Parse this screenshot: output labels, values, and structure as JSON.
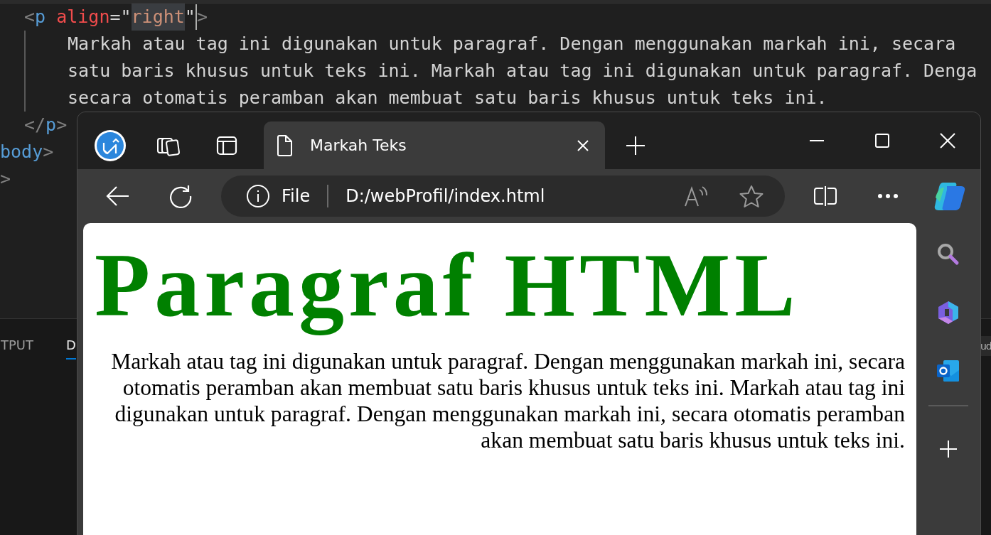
{
  "editor": {
    "lines": [
      {
        "kind": "tag",
        "tokens": [
          {
            "kind": "bracket",
            "text": "<"
          },
          {
            "kind": "tag",
            "text": "p"
          },
          {
            "kind": "attr",
            "text": " align"
          },
          {
            "kind": "plain",
            "text": "=\""
          },
          {
            "kind": "selected-string",
            "text": "right"
          },
          {
            "kind": "plain",
            "text": "\""
          },
          {
            "kind": "bracket",
            "text": ">"
          }
        ]
      },
      {
        "kind": "text",
        "tokens": [
          {
            "kind": "text",
            "text": "Markah atau tag ini digunakan untuk paragraf. Dengan menggunakan markah ini, secara"
          }
        ]
      },
      {
        "kind": "text",
        "tokens": [
          {
            "kind": "text",
            "text": "satu baris khusus untuk teks ini. Markah atau tag ini digunakan untuk paragraf. Denga"
          }
        ]
      },
      {
        "kind": "text",
        "tokens": [
          {
            "kind": "text",
            "text": "secara otomatis peramban akan membuat satu baris khusus untuk teks ini."
          }
        ]
      },
      {
        "kind": "tag",
        "tokens": [
          {
            "kind": "bracket",
            "text": "</"
          },
          {
            "kind": "tag",
            "text": "p"
          },
          {
            "kind": "bracket",
            "text": ">"
          }
        ]
      },
      {
        "kind": "outer",
        "tokens": [
          {
            "kind": "tag",
            "text": "body"
          },
          {
            "kind": "bracket",
            "text": ">"
          }
        ]
      },
      {
        "kind": "outer",
        "tokens": [
          {
            "kind": "bracket",
            "text": ">"
          }
        ]
      }
    ]
  },
  "panel": {
    "tabs": [
      {
        "label": "TPUT",
        "selected": false
      },
      {
        "label": "D",
        "selected": true
      }
    ],
    "right_tab": "ud"
  },
  "browser": {
    "tab": {
      "title": "Markah Teks"
    },
    "address": {
      "scheme": "File",
      "url": "D:/webProfil/index.html"
    },
    "page": {
      "heading": "Paragraf HTML",
      "paragraph": "Markah atau tag ini digunakan untuk paragraf. Dengan menggunakan markah ini, secara otomatis peramban akan membuat satu baris khusus untuk teks ini. Markah atau tag ini digunakan untuk paragraf. Dengan menggunakan markah ini, secara otomatis peramban akan membuat satu baris khusus untuk teks ini."
    }
  }
}
